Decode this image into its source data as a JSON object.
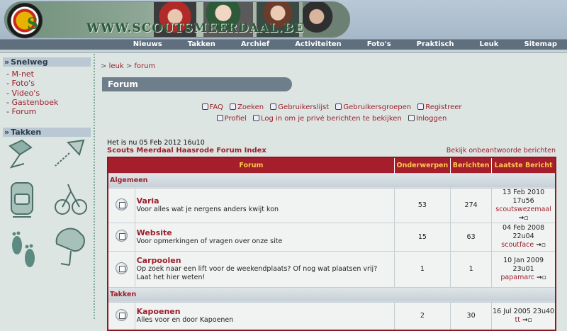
{
  "header": {
    "site_url": "WWW.SCOUTSMEERDAAL.BE",
    "logo_letter": "S"
  },
  "nav": [
    "Nieuws",
    "Takken",
    "Archief",
    "Activiteiten",
    "Foto's",
    "Praktisch",
    "Leuk",
    "Sitemap"
  ],
  "sidebar": {
    "snelweg_title": "Snelweg",
    "links": [
      "M-net",
      "Foto's",
      "Video's",
      "Gastenboek",
      "Forum"
    ],
    "takken_title": "Takken"
  },
  "breadcrumb": {
    "leuk": "leuk",
    "forum": "forum"
  },
  "page_title": "Forum",
  "toplinks": {
    "faq": "FAQ",
    "search": "Zoeken",
    "memberlist": "Gebruikerslijst",
    "usergroups": "Gebruikersgroepen",
    "register": "Registreer",
    "profile": "Profiel",
    "login_pm": "Log in om je privé berichten te bekijken",
    "login": "Inloggen"
  },
  "datetime": "Het is nu 05 Feb 2012 16u10",
  "forum_index": "Scouts Meerdaal Haasrode Forum Index",
  "unanswered": "Bekijk onbeantwoorde berichten",
  "table": {
    "headers": {
      "forum": "Forum",
      "topics": "Onderwerpen",
      "posts": "Berichten",
      "last": "Laatste Bericht"
    },
    "categories": [
      {
        "name": "Algemeen",
        "forums": [
          {
            "name": "Varia",
            "desc": "Voor alles wat je nergens anders kwijt kon",
            "topics": "53",
            "posts": "274",
            "last_date": "13 Feb 2010 17u56",
            "last_user": "scoutswezemaal"
          },
          {
            "name": "Website",
            "desc": "Voor opmerkingen of vragen over onze site",
            "topics": "15",
            "posts": "63",
            "last_date": "04 Feb 2008 22u04",
            "last_user": "scoutface"
          },
          {
            "name": "Carpoolen",
            "desc": "Op zoek naar een lift voor de weekendplaats? Of nog wat plaatsen vrij? Laat het hier weten!",
            "topics": "1",
            "posts": "1",
            "last_date": "10 Jan 2009 23u01",
            "last_user": "papamarc"
          }
        ]
      },
      {
        "name": "Takken",
        "forums": [
          {
            "name": "Kapoenen",
            "desc": "Alles voor en door Kapoenen",
            "topics": "2",
            "posts": "30",
            "last_date": "16 Jul 2005 23u40",
            "last_user": "tt"
          }
        ]
      }
    ]
  },
  "colors": {
    "accent": "#a51e2b",
    "link": "#9b1f2a",
    "header_text": "#ffc94d",
    "navbar": "#5f6f7d"
  }
}
